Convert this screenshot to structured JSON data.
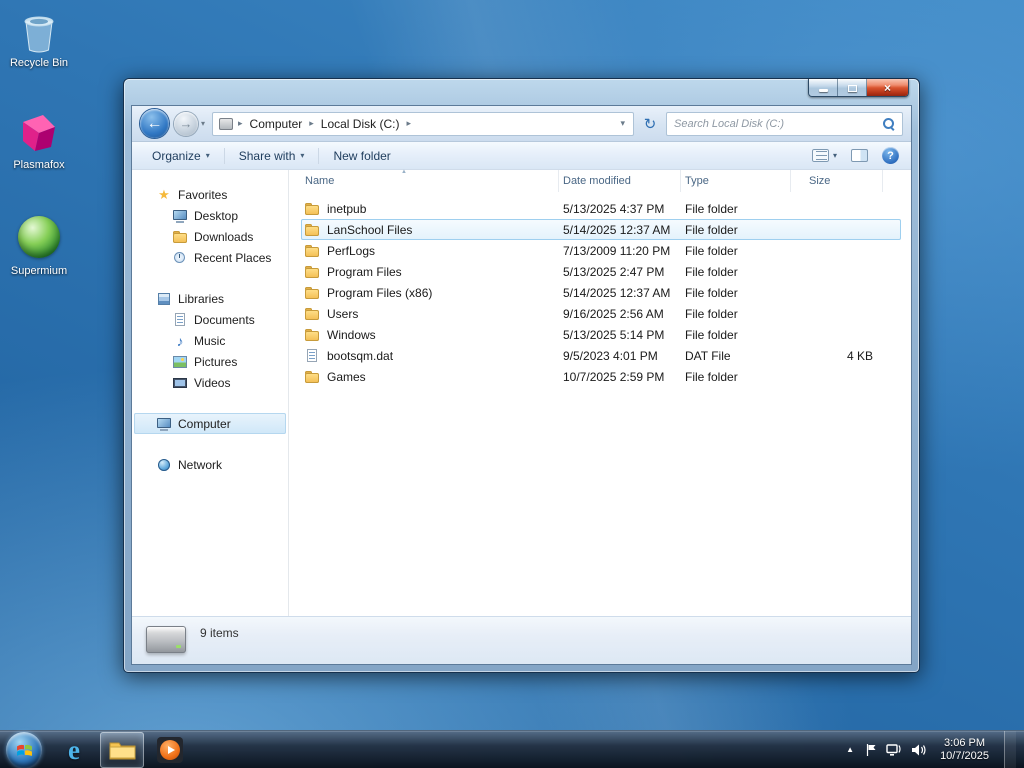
{
  "icons": {
    "back_arrow": "←",
    "forward_arrow": "→",
    "dropdown": "▾",
    "breadcrumb_sep": "▸",
    "refresh": "↻",
    "star": "★",
    "music_note": "♪",
    "help": "?",
    "close": "×",
    "tray_arrow": "▲",
    "sort_asc": "▲"
  },
  "desktop": {
    "icons": [
      {
        "label": "Recycle Bin"
      },
      {
        "label": "Plasmafox"
      },
      {
        "label": "Supermium"
      }
    ]
  },
  "explorer": {
    "breadcrumb": {
      "root": "Computer",
      "drive": "Local Disk (C:)"
    },
    "search": {
      "placeholder": "Search Local Disk (C:)"
    },
    "toolbar": {
      "organize": "Organize",
      "share_with": "Share with",
      "new_folder": "New folder"
    },
    "sidebar": {
      "favorites": {
        "label": "Favorites",
        "items": [
          {
            "label": "Desktop"
          },
          {
            "label": "Downloads"
          },
          {
            "label": "Recent Places"
          }
        ]
      },
      "libraries": {
        "label": "Libraries",
        "items": [
          {
            "label": "Documents"
          },
          {
            "label": "Music"
          },
          {
            "label": "Pictures"
          },
          {
            "label": "Videos"
          }
        ]
      },
      "computer": {
        "label": "Computer"
      },
      "network": {
        "label": "Network"
      }
    },
    "columns": {
      "name": "Name",
      "date": "Date modified",
      "type": "Type",
      "size": "Size"
    },
    "selected_index": 1,
    "files": [
      {
        "name": "inetpub",
        "date": "5/13/2025 4:37 PM",
        "type": "File folder",
        "size": ""
      },
      {
        "name": "LanSchool Files",
        "date": "5/14/2025 12:37 AM",
        "type": "File folder",
        "size": ""
      },
      {
        "name": "PerfLogs",
        "date": "7/13/2009 11:20 PM",
        "type": "File folder",
        "size": ""
      },
      {
        "name": "Program Files",
        "date": "5/13/2025 2:47 PM",
        "type": "File folder",
        "size": ""
      },
      {
        "name": "Program Files (x86)",
        "date": "5/14/2025 12:37 AM",
        "type": "File folder",
        "size": ""
      },
      {
        "name": "Users",
        "date": "9/16/2025 2:56 AM",
        "type": "File folder",
        "size": ""
      },
      {
        "name": "Windows",
        "date": "5/13/2025 5:14 PM",
        "type": "File folder",
        "size": ""
      },
      {
        "name": "bootsqm.dat",
        "date": "9/5/2023 4:01 PM",
        "type": "DAT File",
        "size": "4 KB"
      },
      {
        "name": "Games",
        "date": "10/7/2025 2:59 PM",
        "type": "File folder",
        "size": ""
      }
    ],
    "status": {
      "count": "9 items"
    }
  },
  "taskbar": {
    "clock": {
      "time": "3:06 PM",
      "date": "10/7/2025"
    }
  }
}
